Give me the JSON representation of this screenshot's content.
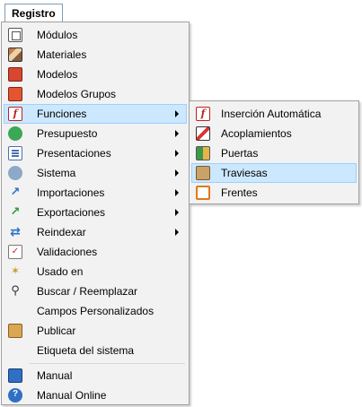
{
  "menubar": {
    "tab_label": "Registro"
  },
  "main_menu": {
    "items": [
      {
        "label": "Módulos",
        "icon": "modules-icon",
        "submenu": false
      },
      {
        "label": "Materiales",
        "icon": "materials-icon",
        "submenu": false
      },
      {
        "label": "Modelos",
        "icon": "models-icon",
        "submenu": false
      },
      {
        "label": "Modelos Grupos",
        "icon": "model-groups-icon",
        "submenu": false
      },
      {
        "label": "Funciones",
        "icon": "function-icon",
        "submenu": true,
        "highlighted": true
      },
      {
        "label": "Presupuesto",
        "icon": "budget-icon",
        "submenu": true
      },
      {
        "label": "Presentaciones",
        "icon": "presentations-icon",
        "submenu": true
      },
      {
        "label": "Sistema",
        "icon": "system-gear-icon",
        "submenu": true
      },
      {
        "label": "Importaciones",
        "icon": "import-icon",
        "submenu": true
      },
      {
        "label": "Exportaciones",
        "icon": "export-icon",
        "submenu": true
      },
      {
        "label": "Reindexar",
        "icon": "reindex-icon",
        "submenu": true
      },
      {
        "label": "Validaciones",
        "icon": "validation-icon",
        "submenu": false
      },
      {
        "label": "Usado en",
        "icon": "used-in-icon",
        "submenu": false
      },
      {
        "label": "Buscar / Reemplazar",
        "icon": "search-icon",
        "submenu": false
      },
      {
        "label": "Campos Personalizados",
        "icon": "",
        "submenu": false
      },
      {
        "label": "Publicar",
        "icon": "publish-icon",
        "submenu": false
      },
      {
        "label": "Etiqueta del sistema",
        "icon": "",
        "submenu": false
      },
      {
        "label": "Manual",
        "icon": "manual-book-icon",
        "submenu": false
      },
      {
        "label": "Manual Online",
        "icon": "help-online-icon",
        "submenu": false
      }
    ]
  },
  "sub_menu": {
    "items": [
      {
        "label": "Inserción Automática",
        "icon": "auto-insert-icon"
      },
      {
        "label": "Acoplamientos",
        "icon": "couplings-icon"
      },
      {
        "label": "Puertas",
        "icon": "doors-icon"
      },
      {
        "label": "Traviesas",
        "icon": "crossbars-icon",
        "highlighted": true
      },
      {
        "label": "Frentes",
        "icon": "fronts-icon"
      }
    ]
  },
  "colors": {
    "highlight_bg": "#cce8ff",
    "highlight_border": "#99d1ff",
    "menu_bg": "#f2f2f2"
  }
}
